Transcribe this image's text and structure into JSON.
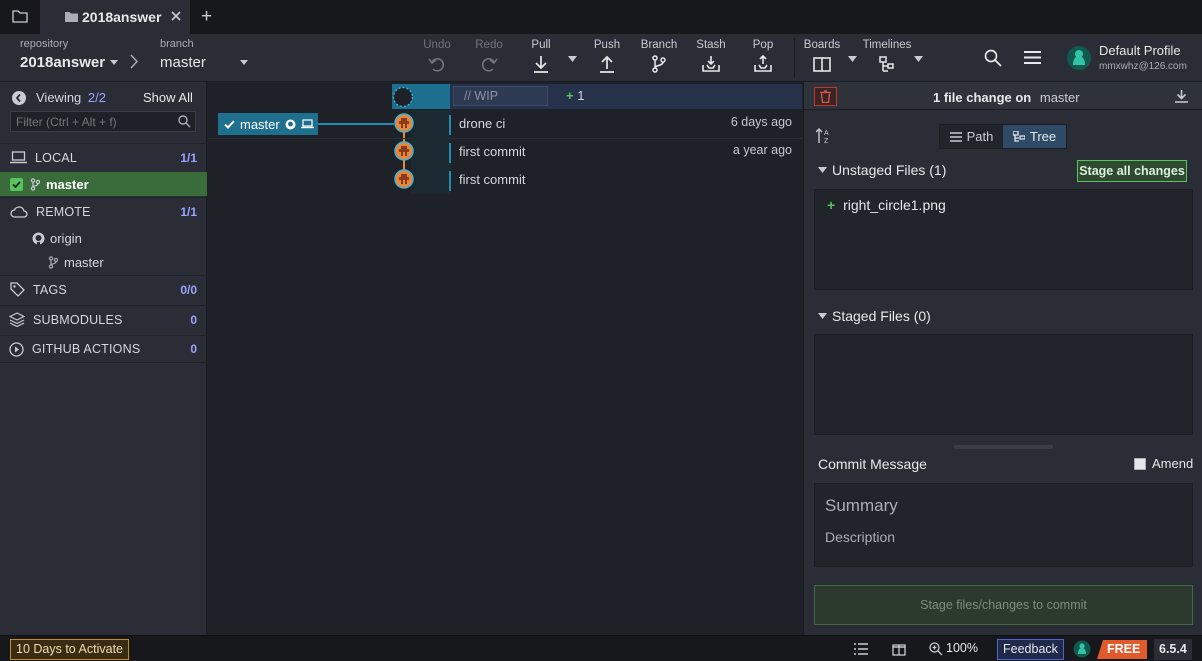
{
  "tabbar": {
    "tab_title": "2018answer",
    "new_tab": "+"
  },
  "toolbar": {
    "repository_label": "repository",
    "repository_name": "2018answer",
    "branch_label": "branch",
    "branch_name": "master",
    "undo": "Undo",
    "redo": "Redo",
    "pull": "Pull",
    "push": "Push",
    "branch": "Branch",
    "stash": "Stash",
    "pop": "Pop",
    "boards": "Boards",
    "timelines": "Timelines",
    "profile_name": "Default Profile",
    "profile_email": "mmxwhz@126.com"
  },
  "left": {
    "viewing_label": "Viewing",
    "viewing_count": "2/2",
    "show_all": "Show All",
    "filter_placeholder": "Filter (Ctrl + Alt + f)",
    "local": {
      "name": "LOCAL",
      "count": "1/1"
    },
    "local_branch": "master",
    "remote": {
      "name": "REMOTE",
      "count": "1/1"
    },
    "remote_origin": "origin",
    "remote_branch": "master",
    "tags": {
      "name": "TAGS",
      "count": "0/0"
    },
    "submodules": {
      "name": "SUBMODULES",
      "count": "0"
    },
    "github_actions": {
      "name": "GITHUB ACTIONS",
      "count": "0"
    }
  },
  "graph": {
    "wip_placeholder": "// WIP",
    "wip_changes": "1",
    "branch_tag": "master",
    "commits": [
      {
        "message": "drone ci",
        "time": "6 days ago"
      },
      {
        "message": "first commit",
        "time": "a year ago"
      },
      {
        "message": "first commit",
        "time": ""
      }
    ]
  },
  "right": {
    "file_change_text": "1 file change on",
    "file_change_branch": "master",
    "path_label": "Path",
    "tree_label": "Tree",
    "unstaged_label": "Unstaged Files (1)",
    "stage_all": "Stage all changes",
    "unstaged_file": "right_circle1.png",
    "staged_label": "Staged Files (0)",
    "commit_message_label": "Commit Message",
    "amend_label": "Amend",
    "summary_placeholder": "Summary",
    "description_placeholder": "Description",
    "commit_button": "Stage files/changes to commit"
  },
  "statusbar": {
    "activate": "10 Days to Activate",
    "zoom": "100%",
    "feedback": "Feedback",
    "free": "FREE",
    "version": "6.5.4"
  },
  "colors": {
    "accent": "#1d8db3",
    "branch_tag_bg": "#1f6f8f",
    "selected_green": "#3a6b3a",
    "commit_orange": "#e8873a",
    "free_badge": "#e05a2b"
  }
}
